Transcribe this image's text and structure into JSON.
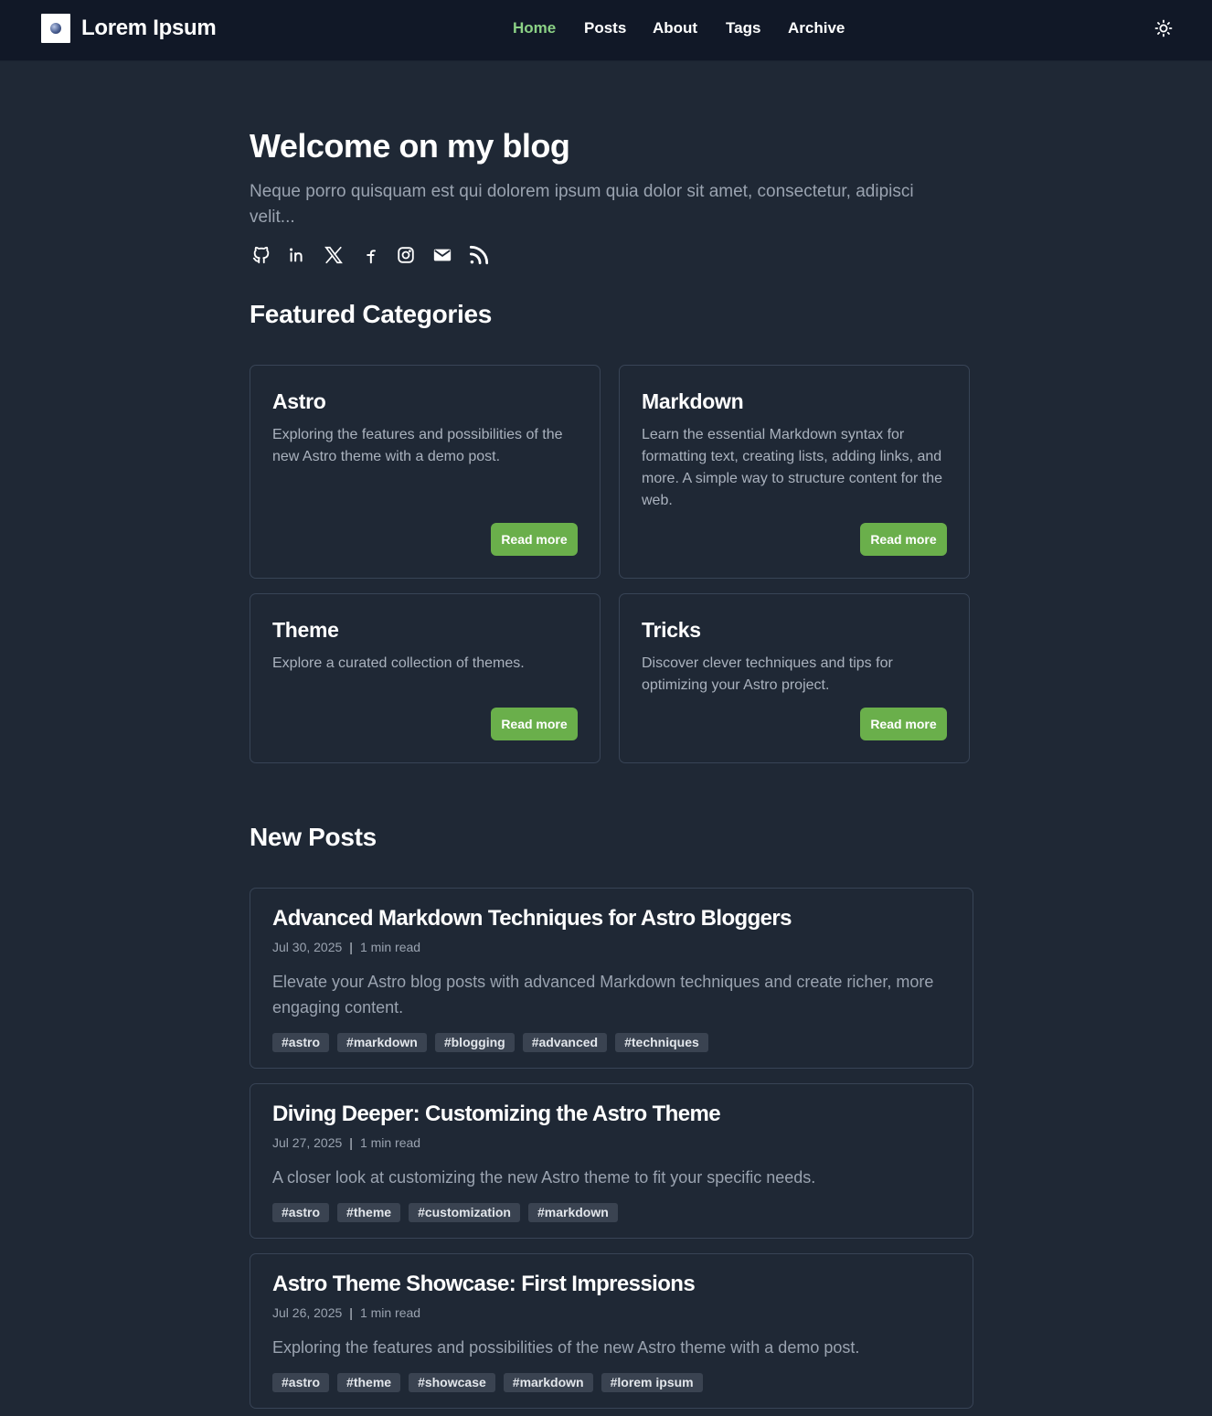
{
  "header": {
    "brand": "Lorem Ipsum",
    "nav": [
      {
        "label": "Home",
        "active": true
      },
      {
        "label": "Posts",
        "active": false
      },
      {
        "label": "About",
        "active": false
      },
      {
        "label": "Tags",
        "active": false
      },
      {
        "label": "Archive",
        "active": false
      }
    ],
    "theme_toggle_icon": "sun-icon"
  },
  "hero": {
    "title": "Welcome on my blog",
    "subtitle": "Neque porro quisquam est qui dolorem ipsum quia dolor sit amet, consectetur, adipisci velit...",
    "socials": [
      "github-icon",
      "linkedin-icon",
      "x-icon",
      "facebook-icon",
      "instagram-icon",
      "mail-icon",
      "rss-icon"
    ]
  },
  "featured": {
    "title": "Featured Categories",
    "categories": [
      {
        "title": "Astro",
        "description": "Exploring the features and possibilities of the new Astro theme with a demo post.",
        "button": "Read more"
      },
      {
        "title": "Markdown",
        "description": "Learn the essential Markdown syntax for formatting text, creating lists, adding links, and more. A simple way to structure content for the web.",
        "button": "Read more"
      },
      {
        "title": "Theme",
        "description": "Explore a curated collection of themes.",
        "button": "Read more"
      },
      {
        "title": "Tricks",
        "description": "Discover clever techniques and tips for optimizing your Astro project.",
        "button": "Read more"
      }
    ]
  },
  "new_posts": {
    "title": "New Posts",
    "posts": [
      {
        "title": "Advanced Markdown Techniques for Astro Bloggers",
        "date": "Jul 30, 2025",
        "separator": "|",
        "read_time": "1 min read",
        "description": "Elevate your Astro blog posts with advanced Markdown techniques and create richer, more engaging content.",
        "tags": [
          "#astro",
          "#markdown",
          "#blogging",
          "#advanced",
          "#techniques"
        ]
      },
      {
        "title": "Diving Deeper: Customizing the Astro Theme",
        "date": "Jul 27, 2025",
        "separator": "|",
        "read_time": "1 min read",
        "description": "A closer look at customizing the new Astro theme to fit your specific needs.",
        "tags": [
          "#astro",
          "#theme",
          "#customization",
          "#markdown"
        ]
      },
      {
        "title": "Astro Theme Showcase: First Impressions",
        "date": "Jul 26, 2025",
        "separator": "|",
        "read_time": "1 min read",
        "description": "Exploring the features and possibilities of the new Astro theme with a demo post.",
        "tags": [
          "#astro",
          "#theme",
          "#showcase",
          "#markdown",
          "#lorem ipsum"
        ]
      }
    ]
  },
  "colors": {
    "background": "#1f2835",
    "header": "#111827",
    "accent_green": "#6aaf4b",
    "nav_active": "#8bd185"
  }
}
